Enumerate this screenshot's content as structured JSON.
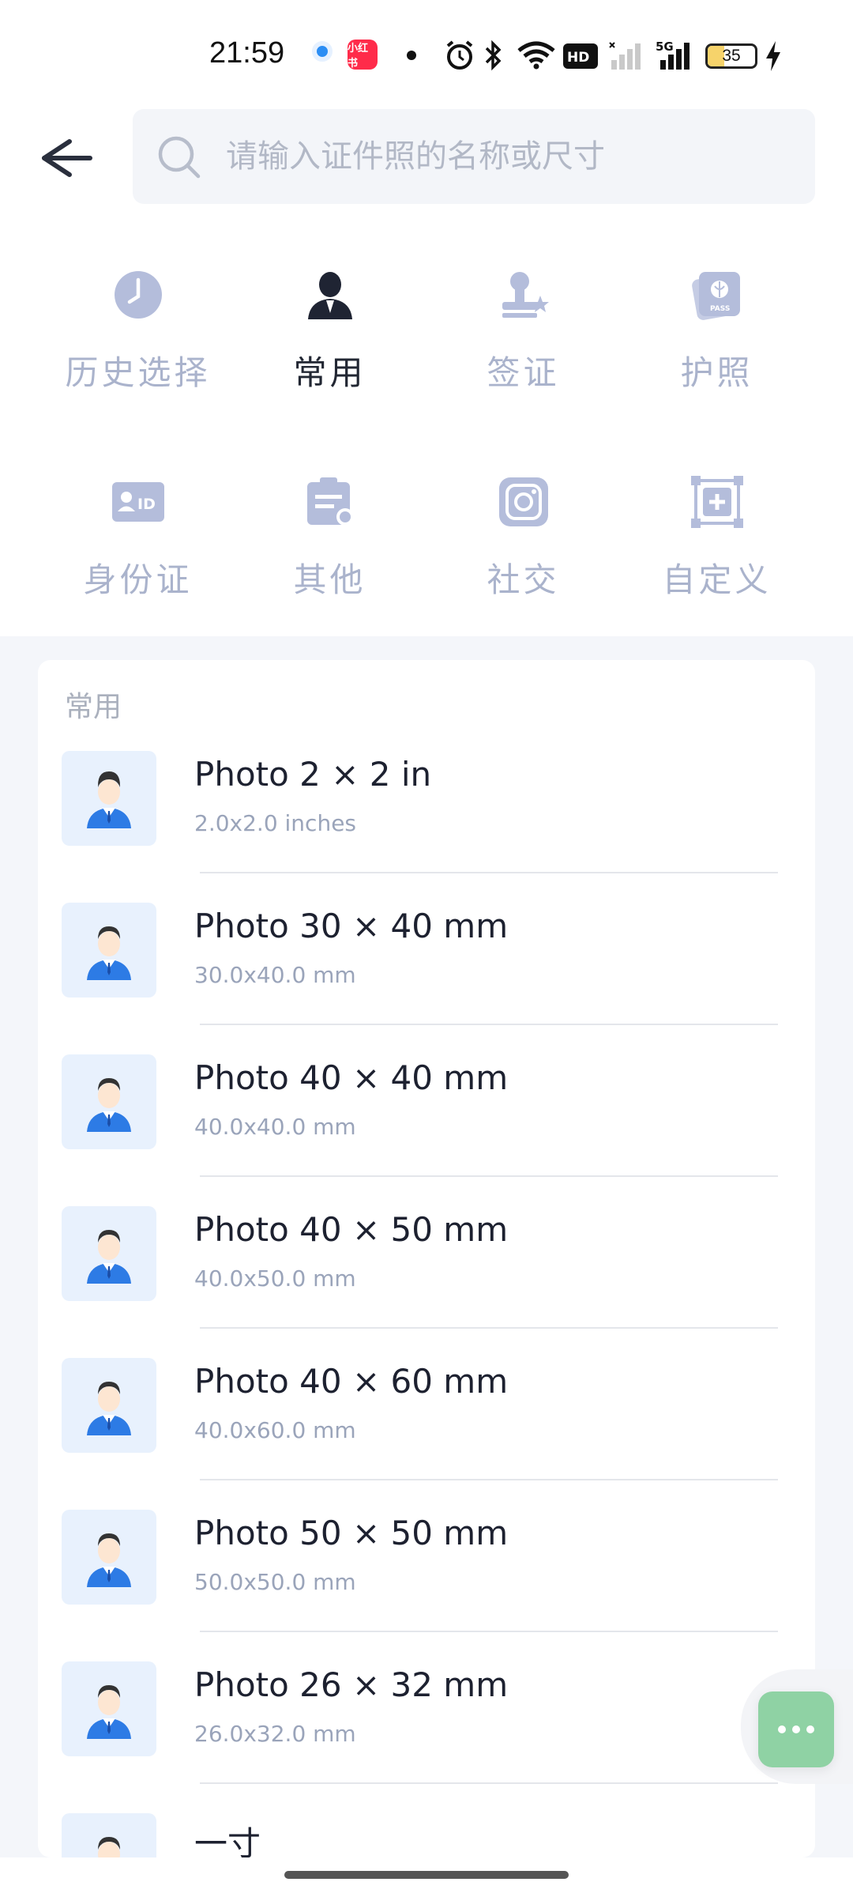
{
  "status_bar": {
    "time": "21:59",
    "app_badge": "小红书",
    "battery": "35",
    "icons": [
      "alarm-icon",
      "bluetooth-icon",
      "wifi-icon",
      "hd-icon",
      "signal-icon",
      "5g-signal-icon",
      "charging-icon"
    ]
  },
  "header": {
    "search_placeholder": "请输入证件照的名称或尺寸"
  },
  "categories": [
    {
      "label": "历史选择",
      "icon": "history-clock-icon",
      "active": false
    },
    {
      "label": "常用",
      "icon": "common-person-icon",
      "active": true
    },
    {
      "label": "签证",
      "icon": "visa-stamp-icon",
      "active": false
    },
    {
      "label": "护照",
      "icon": "passport-icon",
      "active": false
    },
    {
      "label": "身份证",
      "icon": "id-card-icon",
      "active": false
    },
    {
      "label": "其他",
      "icon": "clipboard-icon",
      "active": false
    },
    {
      "label": "社交",
      "icon": "instagram-icon",
      "active": false
    },
    {
      "label": "自定义",
      "icon": "custom-frame-icon",
      "active": false
    }
  ],
  "list": {
    "section_title": "常用",
    "items": [
      {
        "title": "Photo 2 × 2 in",
        "subtitle": "2.0x2.0 inches"
      },
      {
        "title": "Photo 30 × 40 mm",
        "subtitle": "30.0x40.0 mm"
      },
      {
        "title": "Photo 40 × 40 mm",
        "subtitle": "40.0x40.0 mm"
      },
      {
        "title": "Photo 40 × 50 mm",
        "subtitle": "40.0x50.0 mm"
      },
      {
        "title": "Photo 40 × 60 mm",
        "subtitle": "40.0x60.0 mm"
      },
      {
        "title": "Photo 50 × 50 mm",
        "subtitle": "50.0x50.0 mm"
      },
      {
        "title": "Photo 26 × 32 mm",
        "subtitle": "26.0x32.0 mm"
      },
      {
        "title": "一寸",
        "subtitle": ""
      }
    ]
  },
  "colors": {
    "accent_inactive": "#aab3cc",
    "active_text": "#222733",
    "fab": "#8fd2a4",
    "thumb_bg": "#e8f1fd"
  }
}
